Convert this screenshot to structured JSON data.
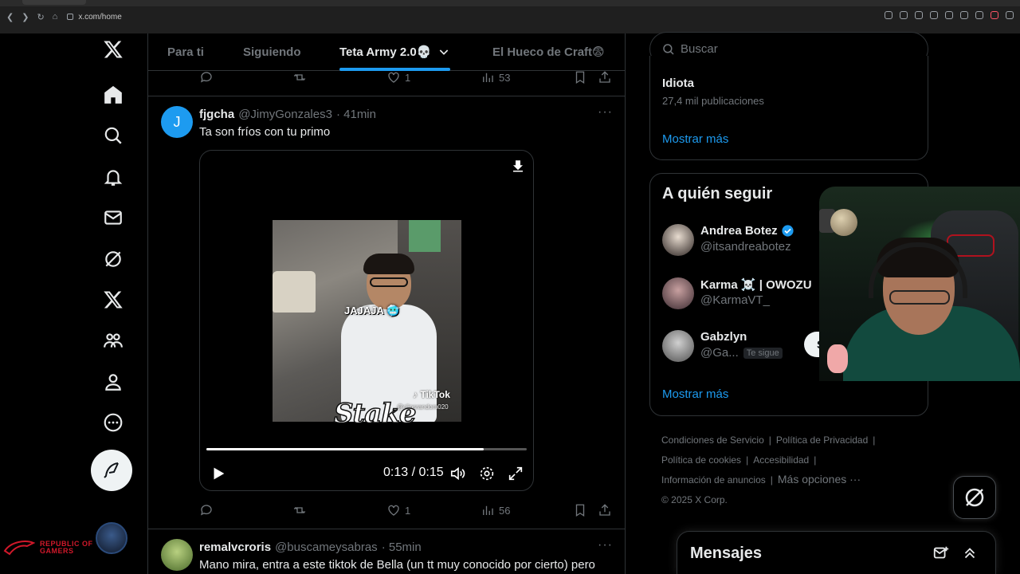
{
  "browser": {
    "url": "x.com/home"
  },
  "tabs": [
    {
      "label": "Para ti",
      "active": false
    },
    {
      "label": "Siguiendo",
      "active": false
    },
    {
      "label": "Teta Army 2.0💀",
      "active": true
    },
    {
      "label": "El Hueco de Craft😨",
      "active": false
    }
  ],
  "feed": {
    "prev_post_actions": {
      "likes": "1",
      "views": "53"
    },
    "post1": {
      "avatar_letter": "J",
      "name": "fjgcha",
      "handle": "@JimyGonzales3",
      "time": "· 41min",
      "text": "Ta son fríos con tu primo",
      "video": {
        "caption": "JAJAJA 🥶",
        "tiktok_label": "TikTok",
        "tiktok_handle": "@clipsrandom020",
        "watermark": "Stake",
        "time_display": "0:13 / 0:15",
        "progress": 0.866
      },
      "actions": {
        "likes": "1",
        "views": "56"
      }
    },
    "post2": {
      "name": "remalvcroris",
      "handle": "@buscameysabras",
      "time": "· 55min",
      "text": "Mano mira, entra a este tiktok de Bella (un tt muy conocido por cierto) pero"
    }
  },
  "sidebar": {
    "search_placeholder": "Buscar",
    "trend": {
      "title": "Idiota",
      "posts": "27,4 mil publicaciones",
      "show_more": "Mostrar más"
    },
    "who_to_follow": {
      "title": "A quién seguir",
      "users": [
        {
          "name": "Andrea Botez",
          "handle": "@itsandreabotez",
          "verified": true
        },
        {
          "name": "Karma ☠️ | OWOZU",
          "handle": "@KarmaVT_",
          "verified": false
        },
        {
          "name": "Gabzlyn",
          "handle": "@Ga...",
          "follows_you": "Te sigue",
          "button": "Se"
        }
      ],
      "show_more": "Mostrar más"
    },
    "footer": {
      "links": [
        "Condiciones de Servicio",
        "Política de Privacidad",
        "Política de cookies",
        "Accesibilidad",
        "Información de anuncios",
        "Más opciones ···"
      ],
      "copyright": "© 2025 X Corp."
    },
    "messages_title": "Mensajes"
  },
  "overlay": {
    "brand": [
      "REPUBLIC OF",
      "GAMERS"
    ]
  },
  "colors": {
    "accent": "#1d9bf0",
    "bg": "#000000",
    "text_secondary": "#71767b"
  }
}
